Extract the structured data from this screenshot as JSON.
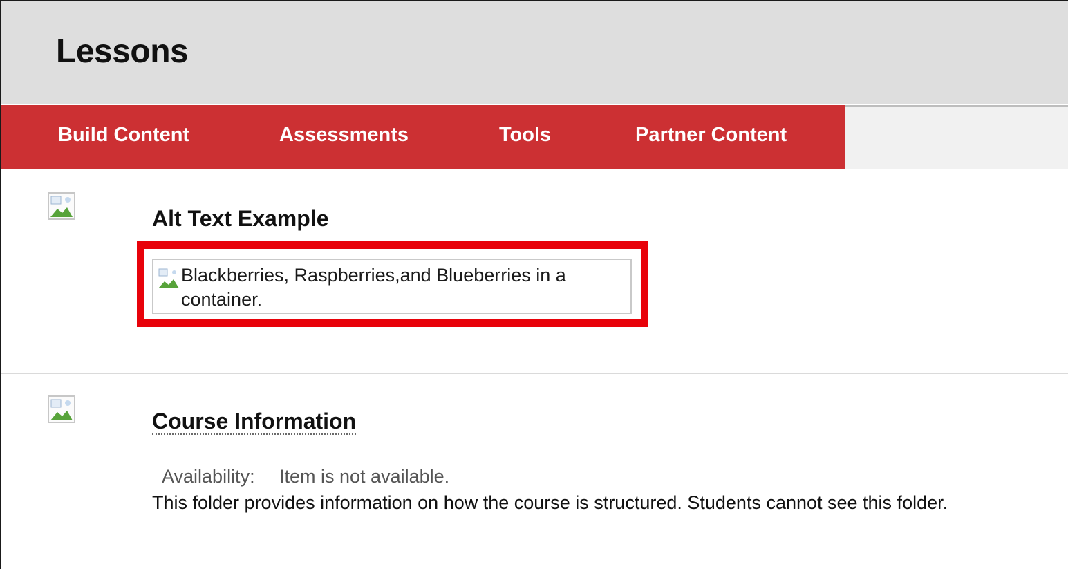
{
  "page": {
    "title": "Lessons"
  },
  "toolbar": {
    "buttons": [
      {
        "label": "Build Content"
      },
      {
        "label": "Assessments"
      },
      {
        "label": "Tools"
      },
      {
        "label": "Partner Content"
      }
    ],
    "background_color": "#cc3033"
  },
  "content_items": [
    {
      "icon": "broken-image-icon",
      "title": "Alt Text Example",
      "image_alt_text": "Blackberries, Raspberries,and Blueberries in a container.",
      "highlight_color": "#e8020a"
    },
    {
      "icon": "broken-image-icon",
      "title": "Course Information",
      "availability_label": "Availability:",
      "availability_value": "Item is not available.",
      "description": "This folder provides information on how the course is structured. Students cannot see this folder."
    }
  ]
}
